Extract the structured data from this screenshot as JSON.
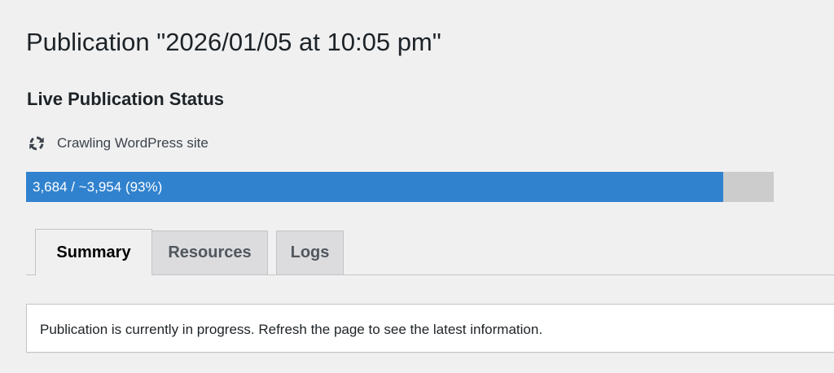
{
  "page": {
    "title": "Publication \"2026/01/05 at 10:05 pm\""
  },
  "status_section": {
    "heading": "Live Publication Status",
    "status_icon": "refresh-icon",
    "status_text": "Crawling WordPress site"
  },
  "progress": {
    "text": "3,684 / ~3,954 (93%)",
    "fraction": 0.932,
    "fill_color": "#3182ce",
    "track_color": "#cccccc"
  },
  "tabs": [
    {
      "label": "Summary",
      "active": true
    },
    {
      "label": "Resources",
      "active": false
    },
    {
      "label": "Logs",
      "active": false
    }
  ],
  "notice": {
    "text": "Publication is currently in progress. Refresh the page to see the latest information."
  }
}
